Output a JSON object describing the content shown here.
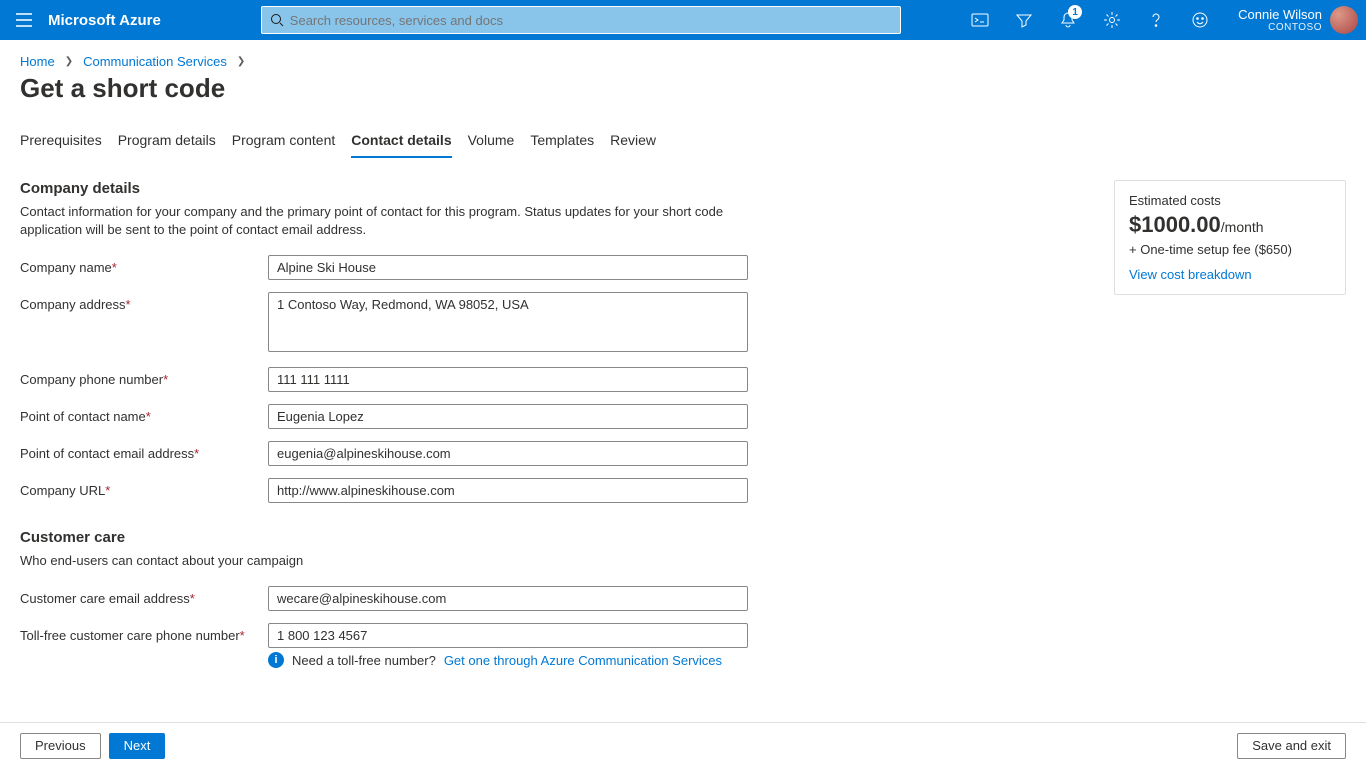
{
  "header": {
    "brand": "Microsoft Azure",
    "search_placeholder": "Search resources, services and docs",
    "notification_count": "1",
    "user_name": "Connie Wilson",
    "directory": "CONTOSO"
  },
  "breadcrumbs": {
    "home": "Home",
    "svc": "Communication Services"
  },
  "page_title": "Get a short code",
  "tabs": {
    "t0": "Prerequisites",
    "t1": "Program details",
    "t2": "Program content",
    "t3": "Contact details",
    "t4": "Volume",
    "t5": "Templates",
    "t6": "Review"
  },
  "cost": {
    "title": "Estimated costs",
    "amount": "$1000.00",
    "per": "/month",
    "setup": "+ One-time setup fee ($650)",
    "link": "View cost breakdown"
  },
  "company": {
    "heading": "Company details",
    "sub": "Contact information for your company and the primary point of contact for this program. Status updates for your short code application will be sent to the point of contact email address.",
    "name_label": "Company name",
    "name_value": "Alpine Ski House",
    "address_label": "Company address",
    "address_value": "1 Contoso Way, Redmond, WA 98052, USA",
    "phone_label": "Company phone number",
    "phone_value": "111 111 1111",
    "poc_label": "Point of contact name",
    "poc_value": "Eugenia Lopez",
    "email_label": "Point of contact email address",
    "email_value": "eugenia@alpineskihouse.com",
    "url_label": "Company URL",
    "url_value": "http://www.alpineskihouse.com"
  },
  "care": {
    "heading": "Customer care",
    "sub": "Who end-users can contact about your campaign",
    "email_label": "Customer care email address",
    "email_value": "wecare@alpineskihouse.com",
    "phone_label": "Toll-free customer care phone number",
    "phone_value": "1 800 123 4567",
    "info_text": "Need a toll-free number?",
    "info_link": "Get one through Azure Communication Services"
  },
  "footer": {
    "prev": "Previous",
    "next": "Next",
    "save": "Save and exit"
  }
}
